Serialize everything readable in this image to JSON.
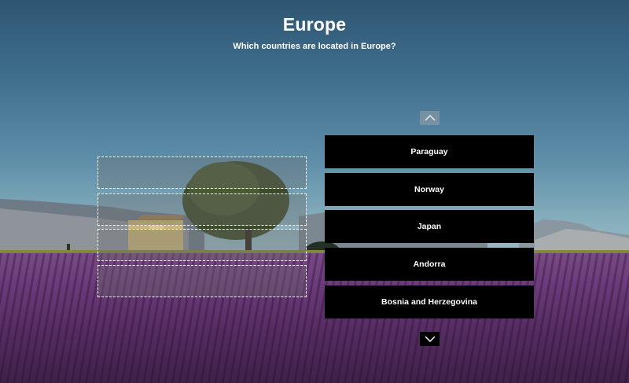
{
  "quiz": {
    "title": "Europe",
    "question": "Which countries are located in Europe?"
  },
  "drop_zones": [
    {
      "id": "slot-1",
      "filled": false
    },
    {
      "id": "slot-2",
      "filled": false
    },
    {
      "id": "slot-3",
      "filled": false
    },
    {
      "id": "slot-4",
      "filled": false
    }
  ],
  "options": [
    {
      "label": "Paraguay"
    },
    {
      "label": "Norway"
    },
    {
      "label": "Japan"
    },
    {
      "label": "Andorra"
    },
    {
      "label": "Bosnia and Herzegovina"
    }
  ],
  "controls": {
    "scroll_up_icon": "chevron-up-icon",
    "scroll_down_icon": "chevron-down-icon"
  },
  "colors": {
    "option_bg": "#000000",
    "option_text": "#ffffff",
    "drop_zone_border": "#ffffff"
  }
}
